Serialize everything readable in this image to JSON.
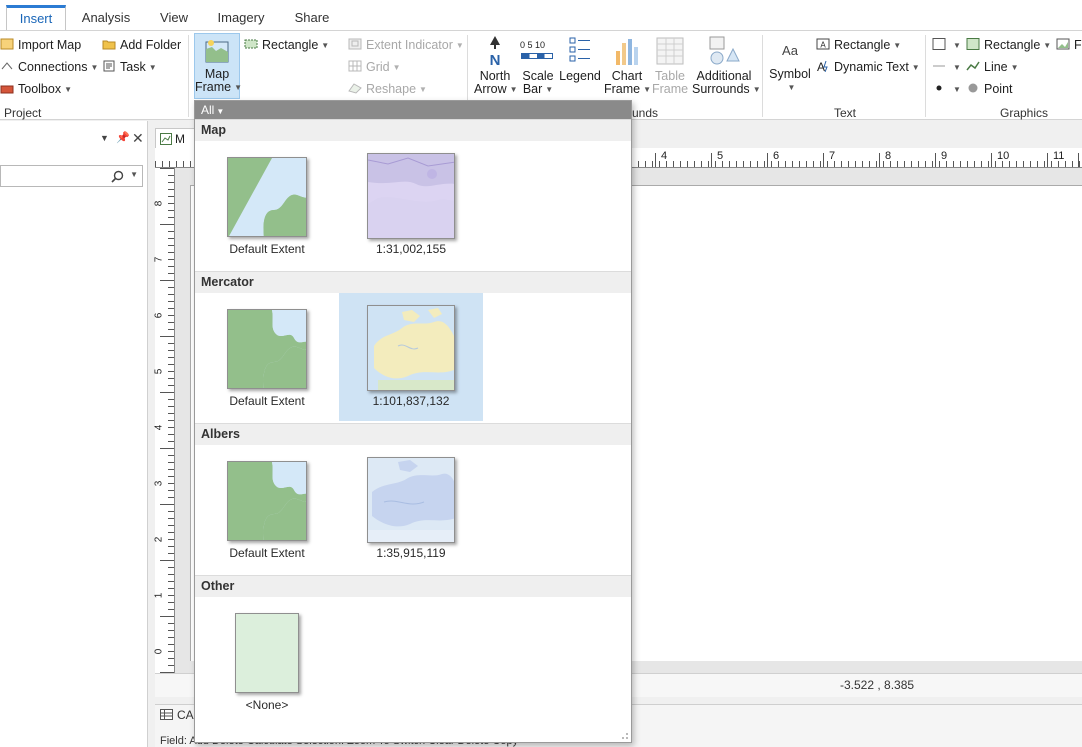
{
  "tabs": [
    "Insert",
    "Analysis",
    "View",
    "Imagery",
    "Share"
  ],
  "ribbon": {
    "project": {
      "label": "Project",
      "import_map": "Import Map",
      "add_folder": "Add Folder",
      "connections": "Connections",
      "task": "Task",
      "toolbox": "Toolbox"
    },
    "map_frame": [
      "Map",
      "Frame"
    ],
    "frame_tools": {
      "rectangle": "Rectangle",
      "extent_indicator": "Extent Indicator",
      "grid": "Grid",
      "reshape": "Reshape"
    },
    "surrounds": {
      "label_fragment": "unds",
      "north_arrow": [
        "North",
        "Arrow"
      ],
      "scale_bar": [
        "Scale",
        "Bar"
      ],
      "scale_bar_ticks": "0 5 10",
      "legend": "Legend",
      "chart_frame": [
        "Chart",
        "Frame"
      ],
      "table_frame": [
        "Table",
        "Frame"
      ],
      "additional_surrounds": [
        "Additional",
        "Surrounds"
      ]
    },
    "text": {
      "label": "Text",
      "symbol": "Symbol",
      "symbol_icon": "Aa",
      "rectangle": "Rectangle",
      "dynamic_text": "Dynamic Text"
    },
    "graphics": {
      "label": "Graphics",
      "rectangle": "Rectangle",
      "line": "Line",
      "point": "Point",
      "fill_fragment": "Fi"
    }
  },
  "view_tab_fragment": "M",
  "gallery": {
    "filter": "All",
    "sections": [
      {
        "title": "Map",
        "items": [
          {
            "label": "Default Extent",
            "thumb": "default"
          },
          {
            "label": "1:31,002,155",
            "thumb": "map-purple"
          }
        ]
      },
      {
        "title": "Mercator",
        "items": [
          {
            "label": "Default Extent",
            "thumb": "default"
          },
          {
            "label": "1:101,837,132",
            "thumb": "map-yellow"
          }
        ]
      },
      {
        "title": "Albers",
        "items": [
          {
            "label": "Default Extent",
            "thumb": "default"
          },
          {
            "label": "1:35,915,119",
            "thumb": "map-blue"
          }
        ]
      },
      {
        "title": "Other",
        "items": [
          {
            "label": "<None>",
            "thumb": "none"
          }
        ]
      }
    ]
  },
  "hruler_labels": [
    "4",
    "5",
    "6",
    "7",
    "8",
    "9",
    "10",
    "11"
  ],
  "vruler_labels": [
    "8",
    "7",
    "6",
    "5",
    "4",
    "3",
    "2",
    "1",
    "0"
  ],
  "status": {
    "coordinates": "-3.522 , 8.385"
  },
  "attribute": {
    "tab_label_fragment": "CA",
    "bar_text": "Field:  Add   Delete   Calculate     Selection:  Zoom To   Switch   Clear   Delete   Copy"
  },
  "colors": {
    "accent": "#2b7bd3",
    "selected": "#cfe3f4",
    "land": "#93bf8b",
    "water": "#d4e8f8"
  }
}
